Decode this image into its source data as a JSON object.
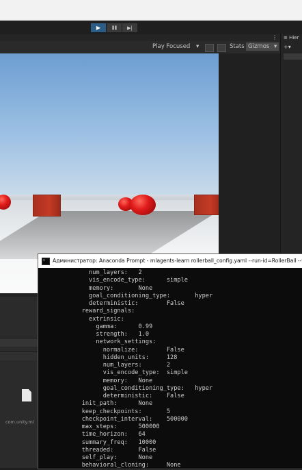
{
  "toolbar": {
    "play_icon": "play-icon",
    "pause_icon": "pause-icon",
    "step_icon": "step-icon",
    "play_symbol": "▶",
    "pause_symbol": "❚❚",
    "step_symbol": "▶|"
  },
  "game_view": {
    "play_mode": "Play Focused",
    "stats_label": "Stats",
    "gizmos_label": "Gizmos",
    "dropdown_symbol": "▾",
    "add_symbol": "+▾"
  },
  "hierarchy": {
    "tab_label": "≡ Hier"
  },
  "project": {
    "file_label": "com.unity.ml"
  },
  "console": {
    "title": "Администратор: Anaconda Prompt - mlagents-learn  rollerball_config.yaml --run-id=RollerBall --fo",
    "lines": [
      "      num_layers:   2",
      "      vis_encode_type:      simple",
      "      memory:       None",
      "      goal_conditioning_type:       hyper",
      "      deterministic:        False",
      "    reward_signals:",
      "      extrinsic:",
      "        gamma:      0.99",
      "        strength:   1.0",
      "        network_settings:",
      "          normalize:        False",
      "          hidden_units:     128",
      "          num_layers:       2",
      "          vis_encode_type:  simple",
      "          memory:   None",
      "          goal_conditioning_type:   hyper",
      "          deterministic:    False",
      "    init_path:      None",
      "    keep_checkpoints:       5",
      "    checkpoint_interval:    500000",
      "    max_steps:      500000",
      "    time_horizon:   64",
      "    summary_freq:   10000",
      "    threaded:       False",
      "    self_play:      None",
      "    behavioral_cloning:     None"
    ]
  },
  "colors": {
    "play_active": "#2c5d87",
    "console_bg": "#0c0c0c",
    "console_text": "#cfcfcf",
    "sphere_red": "#e01b1b",
    "cube_red": "#b3321f"
  }
}
